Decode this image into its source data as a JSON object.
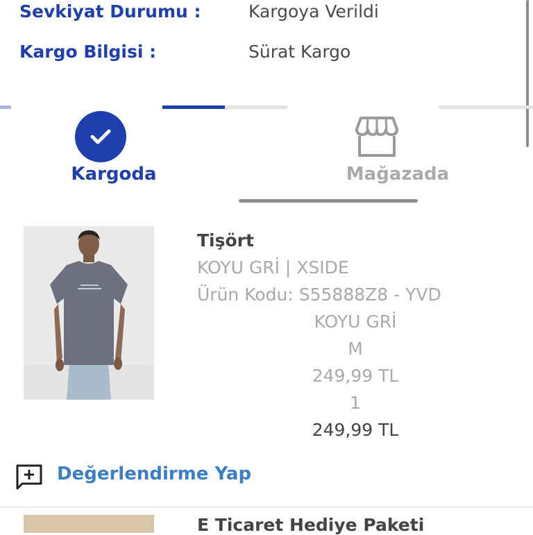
{
  "shipment": {
    "status_label": "Sevkiyat Durumu :",
    "status_value": "Kargoya Verildi",
    "carrier_label": "Kargo Bilgisi :",
    "carrier_value": "Sürat Kargo"
  },
  "steps": [
    {
      "label": "Kargoda",
      "state": "active",
      "icon": "check-icon"
    },
    {
      "label": "Mağazada",
      "state": "inactive",
      "icon": "store-icon"
    }
  ],
  "product": {
    "title": "Tişört",
    "variant": "KOYU GRİ | XSIDE",
    "code": "Ürün Kodu: S55888Z8 - YVD",
    "color": "KOYU GRİ",
    "size": "M",
    "unit_price": "249,99 TL",
    "quantity": "1",
    "total_price": "249,99 TL"
  },
  "review": {
    "label": "Değerlendirme Yap",
    "icon": "add-box-icon"
  },
  "next_product": {
    "title": "E Ticaret Hediye Paketi"
  },
  "colors": {
    "accent": "#1f3fae",
    "link": "#3a7fc4",
    "muted": "#a9a9a9"
  }
}
